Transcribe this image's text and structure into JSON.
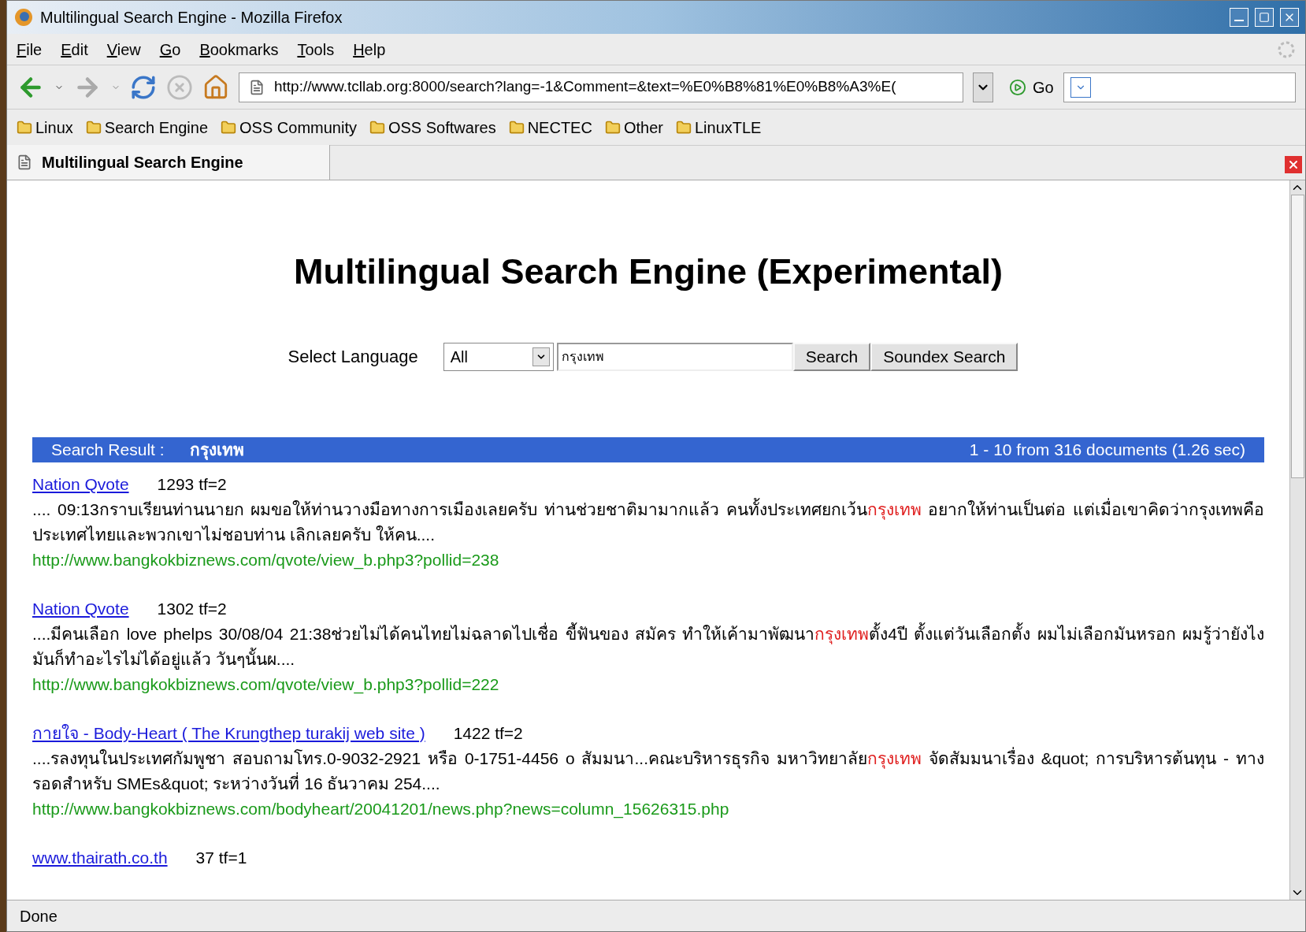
{
  "window": {
    "title": "Multilingual Search Engine - Mozilla Firefox"
  },
  "menu": [
    {
      "label": "File"
    },
    {
      "label": "Edit"
    },
    {
      "label": "View"
    },
    {
      "label": "Go"
    },
    {
      "label": "Bookmarks"
    },
    {
      "label": "Tools"
    },
    {
      "label": "Help"
    }
  ],
  "navigation": {
    "address": "http://www.tcllab.org:8000/search?lang=-1&Comment=&text=%E0%B8%81%E0%B8%A3%E(",
    "go_label": "Go"
  },
  "bookmarks": [
    "Linux",
    "Search Engine",
    "OSS Community",
    "OSS Softwares",
    "NECTEC",
    "Other",
    "LinuxTLE"
  ],
  "tabs": [
    {
      "label": "Multilingual Search Engine",
      "selected": true
    }
  ],
  "page": {
    "heading": "Multilingual Search Engine (Experimental)",
    "form": {
      "label": "Select Language",
      "language": "All",
      "query": "กรุงเทพ",
      "buttons": [
        "Search",
        "Soundex Search"
      ]
    },
    "result_bar": {
      "label": "Search Result :",
      "query": "กรุงเทพ",
      "summary": "1 - 10 from 316 documents (1.26 sec)"
    },
    "results": [
      {
        "title": "Nation Qvote",
        "meta": "1293 tf=2",
        "snippet": [
          {
            "text": ".... 09:13กราบเรียนท่านนายก ผมขอให้ท่านวางมือทางการเมืองเลยครับ ท่านช่วยชาติมามากแล้ว คนทั้งประเทศยกเว้น",
            "highlight": false
          },
          {
            "text": "กรุงเทพ",
            "highlight": true
          },
          {
            "text": " อยากให้ท่านเป็นต่อ แต่เมื่อเขาคิดว่ากรุงเทพคือประเทศไทยและพวกเขาไม่ชอบท่าน เลิกเลยครับ ให้คน....",
            "highlight": false
          }
        ],
        "url": "http://www.bangkokbiznews.com/qvote/view_b.php3?pollid=238"
      },
      {
        "title": "Nation Qvote",
        "meta": "1302 tf=2",
        "snippet": [
          {
            "text": "....มีคนเลือก love phelps 30/08/04 21:38ช่วยไม่ได้คนไทยไม่ฉลาดไปเชื่อ ขี้ฟันของ สมัคร ทำให้เค้ามาพัฒนา",
            "highlight": false
          },
          {
            "text": "กรุงเทพ",
            "highlight": true
          },
          {
            "text": "ตั้ง4ปี ตั้งแต่วันเลือกตั้ง ผมไม่เลือกมันหรอก ผมรู้ว่ายังไงมันก็ทำอะไรไม่ได้อยู่แล้ว วันๆนั้นผ....",
            "highlight": false
          }
        ],
        "url": "http://www.bangkokbiznews.com/qvote/view_b.php3?pollid=222"
      },
      {
        "title": "กายใจ - Body-Heart ( The Krungthep turakij web site )",
        "meta": "1422 tf=2",
        "snippet": [
          {
            "text": "....รลงทุนในประเทศกัมพูชา สอบถามโทร.0-9032-2921 หรือ 0-1751-4456 o สัมมนา...คณะบริหารธุรกิจ มหาวิทยาลัย",
            "highlight": false
          },
          {
            "text": "กรุงเทพ",
            "highlight": true
          },
          {
            "text": " จัดสัมมนาเรื่อง &quot; การบริหารต้นทุน - ทางรอดสำหรับ SMEs&quot; ระหว่างวันที่ 16 ธันวาคม 254....",
            "highlight": false
          }
        ],
        "url": "http://www.bangkokbiznews.com/bodyheart/20041201/news.php?news=column_15626315.php"
      },
      {
        "title": "www.thairath.co.th",
        "meta": "37 tf=1"
      }
    ]
  },
  "status_bar": "Done"
}
